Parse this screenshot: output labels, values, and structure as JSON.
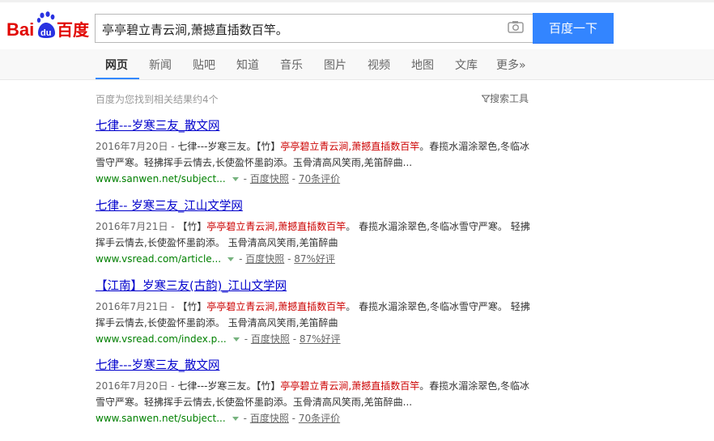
{
  "brand": {
    "logo_text_left": "Bai",
    "logo_text_paw": "du",
    "logo_text_right": "百度"
  },
  "search": {
    "query": "亭亭碧立青云涧,萧撼直插数百竿。",
    "button_label": "百度一下"
  },
  "tabs": [
    {
      "label": "网页",
      "active": true
    },
    {
      "label": "新闻"
    },
    {
      "label": "贴吧"
    },
    {
      "label": "知道"
    },
    {
      "label": "音乐"
    },
    {
      "label": "图片"
    },
    {
      "label": "视频"
    },
    {
      "label": "地图"
    },
    {
      "label": "文库"
    },
    {
      "label": "更多»"
    }
  ],
  "results_info": "百度为您找到相关结果约4个",
  "search_tools": "搜索工具",
  "results": [
    {
      "title": "七律---岁寒三友_散文网",
      "date": "2016年7月20日 -",
      "pre": " 七律---岁寒三友。【竹】",
      "em": "亭亭碧立青云涧,萧撼直插数百竿",
      "post": "。春揽水湄涂翠色,冬临冰雪守严寒。轻拂挥手云情去,长使盈怀墨韵添。玉骨清高风笑雨,羌笛醉曲...",
      "url": "www.sanwen.net/subject...",
      "cache": "百度快照",
      "rating": "70条评价"
    },
    {
      "title": "七律-- 岁寒三友_江山文学网",
      "date": "2016年7月21日 -",
      "pre": " 【竹】",
      "em": "亭亭碧立青云涧,萧撼直插数百竿",
      "post": "。 春揽水湄涂翠色,冬临冰雪守严寒。 轻拂挥手云情去,长使盈怀墨韵添。 玉骨清高风笑雨,羌笛醉曲",
      "url": "www.vsread.com/article...",
      "cache": "百度快照",
      "rating": "87%好评"
    },
    {
      "title": "【江南】岁寒三友(古韵)_江山文学网",
      "date": "2016年7月21日 -",
      "pre": " 【竹】",
      "em": "亭亭碧立青云涧,萧撼直插数百竿",
      "post": "。 春揽水湄涂翠色,冬临冰雪守严寒。 轻拂挥手云情去,长使盈怀墨韵添。 玉骨清高风笑雨,羌笛醉曲",
      "url": "www.vsread.com/index.p...",
      "cache": "百度快照",
      "rating": "87%好评"
    },
    {
      "title": "七律---岁寒三友_散文网",
      "date": "2016年7月20日 -",
      "pre": " 七律---岁寒三友。【竹】",
      "em": "亭亭碧立青云涧,萧撼直插数百竿",
      "post": "。春揽水湄涂翠色,冬临冰雪守严寒。轻拂挥手云情去,长使盈怀墨韵添。玉骨清高风笑雨,羌笛醉曲...",
      "url": "www.sanwen.net/subject...",
      "cache": "百度快照",
      "rating": "70条评价"
    }
  ],
  "colors": {
    "brand_red": "#e10601",
    "brand_blue": "#2932e1",
    "button": "#3385ff",
    "link": "#0000cc",
    "highlight": "#cc0000",
    "url": "#008000"
  }
}
